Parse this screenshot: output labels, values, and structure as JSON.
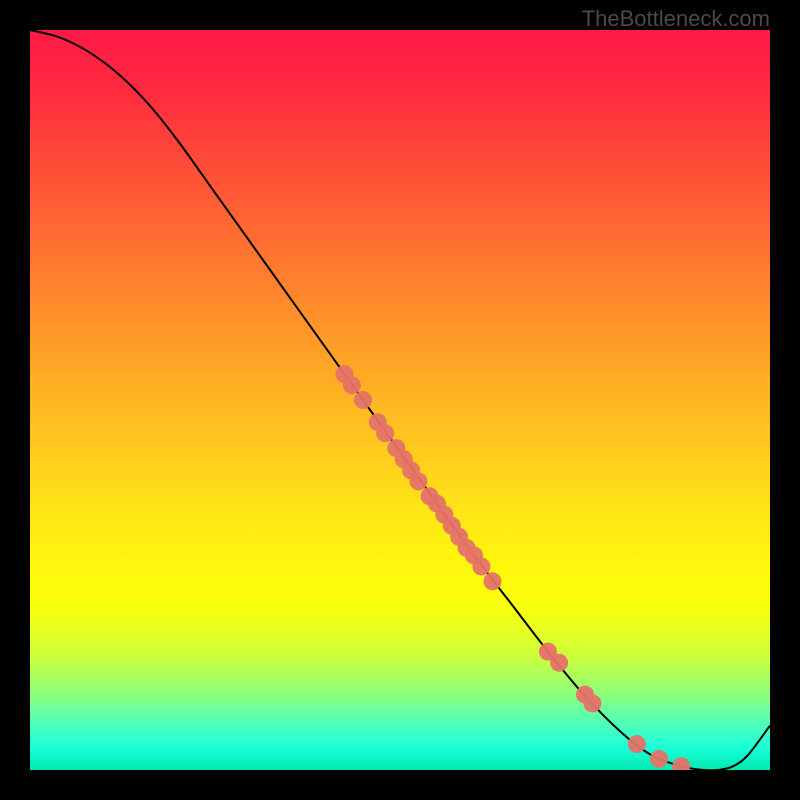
{
  "watermark": "TheBottleneck.com",
  "chart_data": {
    "type": "line",
    "title": "",
    "xlabel": "",
    "ylabel": "",
    "xlim": [
      0,
      100
    ],
    "ylim": [
      0,
      100
    ],
    "curve": {
      "x": [
        0,
        4,
        8,
        12,
        16,
        20,
        25,
        30,
        35,
        40,
        45,
        50,
        55,
        60,
        65,
        70,
        75,
        80,
        84,
        88,
        91,
        93,
        95,
        97,
        100
      ],
      "y": [
        100,
        99,
        97,
        94,
        90,
        85,
        78,
        71,
        64,
        57,
        50,
        43,
        36,
        29,
        22.5,
        16,
        10,
        5,
        2,
        0.5,
        0,
        0,
        0.5,
        2,
        6
      ]
    },
    "markers": [
      {
        "x": 42.5,
        "y": 53.5
      },
      {
        "x": 43.5,
        "y": 52.0
      },
      {
        "x": 45.0,
        "y": 50.0
      },
      {
        "x": 47.0,
        "y": 47.0
      },
      {
        "x": 48.0,
        "y": 45.5
      },
      {
        "x": 49.5,
        "y": 43.5
      },
      {
        "x": 50.5,
        "y": 42.0
      },
      {
        "x": 51.5,
        "y": 40.5
      },
      {
        "x": 52.5,
        "y": 39.0
      },
      {
        "x": 54.0,
        "y": 37.0
      },
      {
        "x": 55.0,
        "y": 36.0
      },
      {
        "x": 56.0,
        "y": 34.5
      },
      {
        "x": 57.0,
        "y": 33.0
      },
      {
        "x": 58.0,
        "y": 31.5
      },
      {
        "x": 59.0,
        "y": 30.0
      },
      {
        "x": 60.0,
        "y": 29.0
      },
      {
        "x": 61.0,
        "y": 27.5
      },
      {
        "x": 62.5,
        "y": 25.5
      },
      {
        "x": 70.0,
        "y": 16.0
      },
      {
        "x": 71.5,
        "y": 14.5
      },
      {
        "x": 75.0,
        "y": 10.2
      },
      {
        "x": 76.0,
        "y": 9.0
      },
      {
        "x": 82.0,
        "y": 3.5
      },
      {
        "x": 85.0,
        "y": 1.5
      },
      {
        "x": 88.0,
        "y": 0.5
      }
    ],
    "marker_color": "#e57368",
    "curve_color": "#000000"
  }
}
